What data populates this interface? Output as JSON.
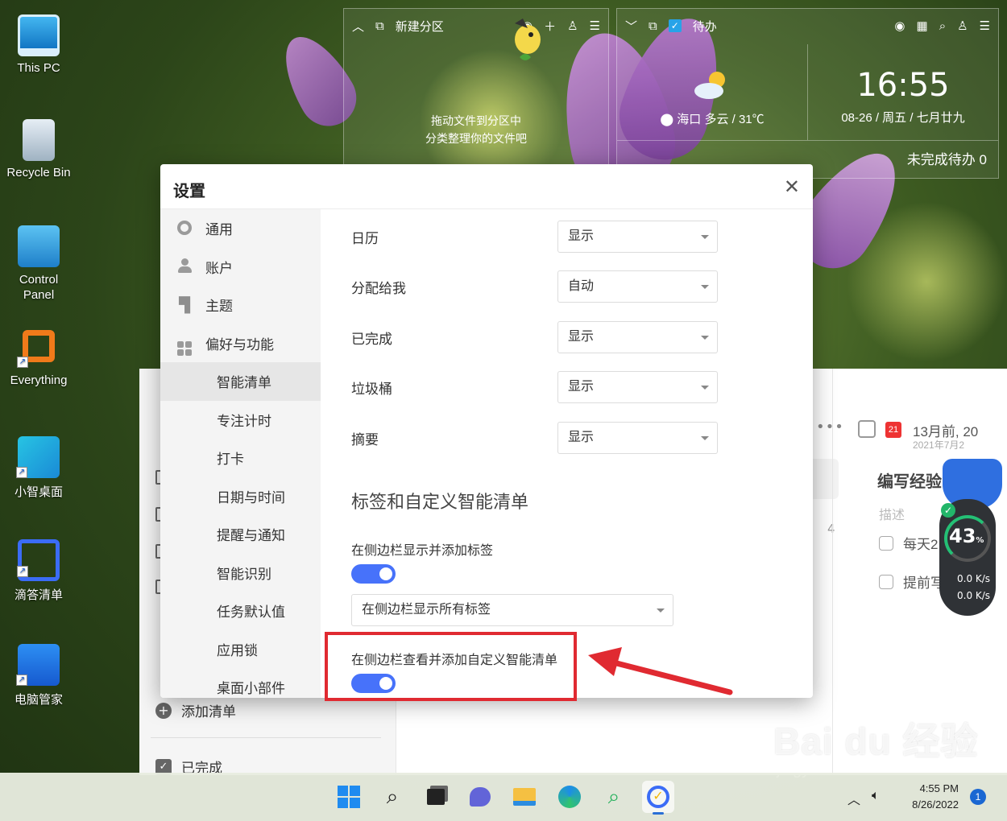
{
  "desktop": {
    "icons": [
      {
        "label": "This PC",
        "icon": "monitor-icon"
      },
      {
        "label": "Recycle Bin",
        "icon": "recycle-bin-icon"
      },
      {
        "label": "Control Panel",
        "icon": "control-panel-icon"
      },
      {
        "label": "Everything",
        "icon": "search-magnifier-icon"
      },
      {
        "label": "小智桌面",
        "icon": "xiaozhi-desktop-icon"
      },
      {
        "label": "滴答清单",
        "icon": "dida-checkmark-icon"
      },
      {
        "label": "电脑管家",
        "icon": "shield-icon"
      }
    ]
  },
  "widget_partition": {
    "title": "新建分区",
    "hint_line1": "拖动文件到分区中",
    "hint_line2": "分类整理你的文件吧"
  },
  "widget_todo": {
    "title": "待办",
    "weather": "海口 多云 / 31℃",
    "time": "16:55",
    "date": "08-26 / 周五 / 七月廿九",
    "unfinished": "未完成待办 0"
  },
  "settings": {
    "title": "设置",
    "nav": {
      "general": "通用",
      "account": "账户",
      "theme": "主题",
      "preferences": "偏好与功能",
      "smart_list": "智能清单",
      "focus": "专注计时",
      "checkin": "打卡",
      "datetime": "日期与时间",
      "reminders": "提醒与通知",
      "smart_recognition": "智能识别",
      "task_defaults": "任务默认值",
      "app_lock": "应用锁",
      "desktop_widgets": "桌面小部件"
    },
    "rows": [
      {
        "label": "日历",
        "value": "显示"
      },
      {
        "label": "分配给我",
        "value": "自动"
      },
      {
        "label": "已完成",
        "value": "显示"
      },
      {
        "label": "垃圾桶",
        "value": "显示"
      },
      {
        "label": "摘要",
        "value": "显示"
      }
    ],
    "section_title": "标签和自定义智能清单",
    "tags_label": "在侧边栏显示并添加标签",
    "tags_toggle_on": true,
    "tags_select": "在侧边栏显示所有标签",
    "custom_label": "在侧边栏查看并添加自定义智能清单",
    "custom_toggle_on": true
  },
  "app_bg": {
    "add_list": "添加清单",
    "completed": "已完成",
    "count": "4",
    "detail_date": "13月前, 20",
    "detail_date_sub": "2021年7月2",
    "detail_title": "编写经验",
    "detail_desc": "描述",
    "check1": "每天2",
    "check2": "提前写"
  },
  "monitor": {
    "percent": "43",
    "percent_unit": "%",
    "up": "0.0 K/s",
    "down": "0.0 K/s"
  },
  "watermark": {
    "main": "Bai du 经验",
    "sub": "jingyan.baidu.com"
  },
  "taskbar": {
    "time": "4:55 PM",
    "date": "8/26/2022",
    "notifications": "1"
  },
  "colors": {
    "accent": "#4772fa",
    "highlight_red": "#e02a31",
    "taskbar_bg": "#e8ece0"
  }
}
